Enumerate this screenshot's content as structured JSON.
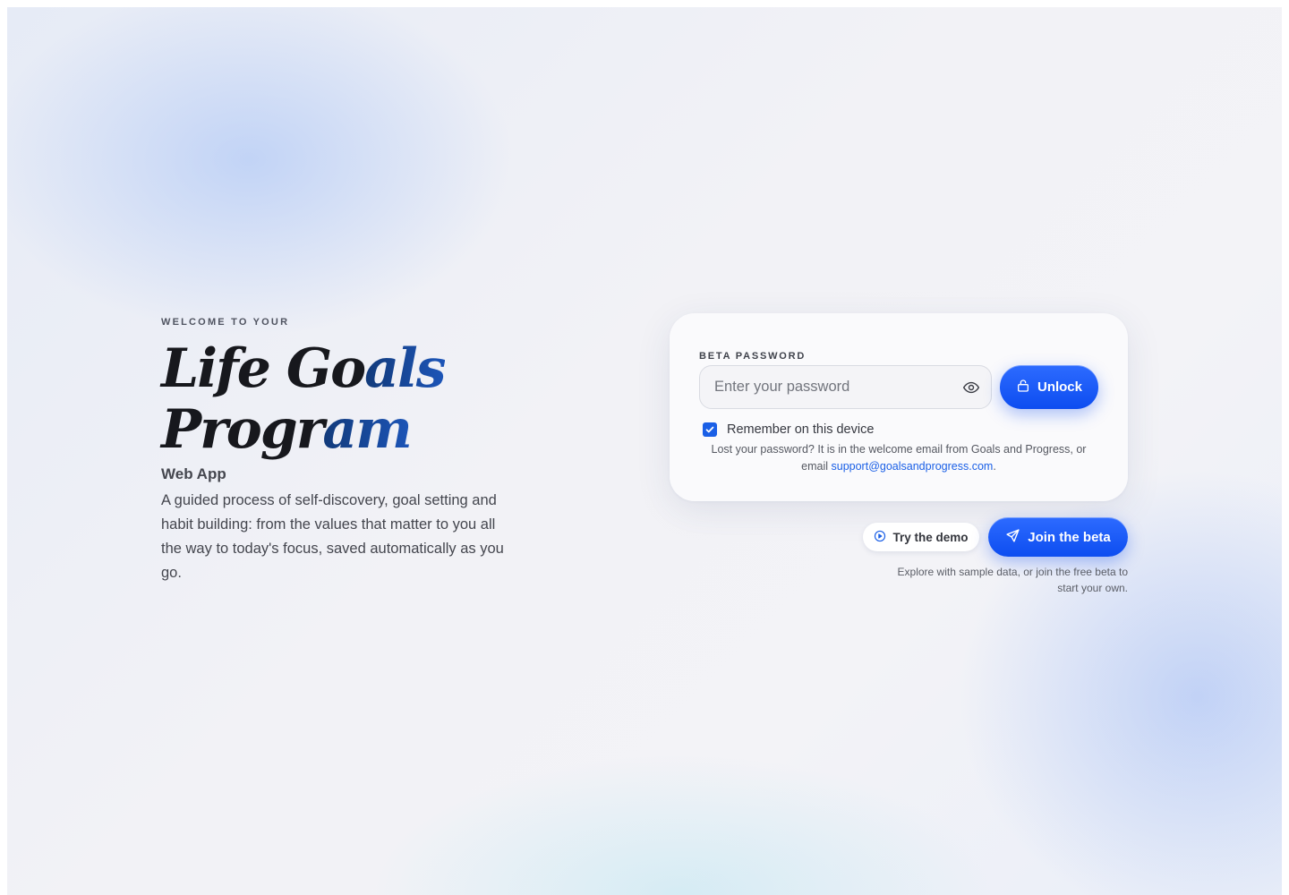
{
  "hero": {
    "eyebrow": "WELCOME TO YOUR",
    "title_part1": "Life Go",
    "title_part1_accent": "als",
    "title_part2": "Progr",
    "title_part2_accent": "am",
    "subtitle": "Web App",
    "description": "A guided process of self-discovery, goal setting and habit building: from the values that matter to you all the way to today's focus, saved automatically as you go."
  },
  "login": {
    "label": "BETA PASSWORD",
    "password_placeholder": "Enter your password",
    "password_value": "",
    "toggle_visibility_icon": "eye-icon",
    "unlock_icon": "lock-icon",
    "unlock_label": "Unlock",
    "remember_label": "Remember on this device",
    "remember_checked": true,
    "help_text": "Lost your password? It is in the welcome email from Goals and Progress, or email ",
    "support_email": "support@goalsandprogress.com",
    "help_suffix": "."
  },
  "actions": {
    "demo_icon": "play-circle-icon",
    "demo_label": "Try the demo",
    "beta_icon": "send-icon",
    "beta_label": "Join the beta",
    "note": "Explore with sample data, or join the free beta to start your own."
  },
  "colors": {
    "accent": "#1a5fe6",
    "button_gradient_top": "#2d6bff",
    "button_gradient_bottom": "#0d4df0",
    "title_accent": "#1c55b8"
  }
}
